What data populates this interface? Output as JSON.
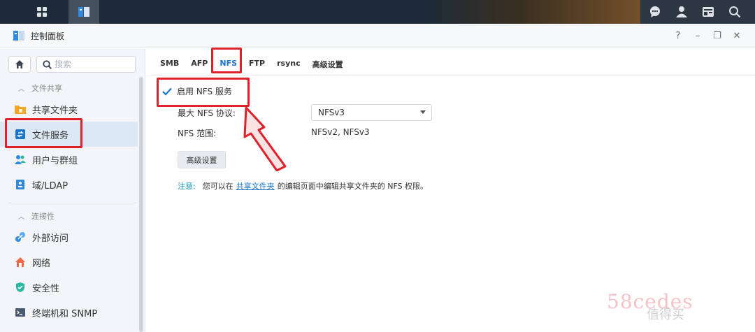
{
  "window": {
    "title": "控制面板",
    "controls": [
      "?",
      "–",
      "❐",
      "✕"
    ]
  },
  "sidebar": {
    "search_placeholder": "搜索",
    "groups": [
      {
        "header": "文件共享",
        "items": [
          {
            "label": "共享文件夹",
            "icon": "folder-icon"
          },
          {
            "label": "文件服务",
            "icon": "file-services-icon",
            "selected": true
          },
          {
            "label": "用户与群组",
            "icon": "users-icon"
          },
          {
            "label": "域/LDAP",
            "icon": "domain-icon"
          }
        ]
      },
      {
        "header": "连接性",
        "items": [
          {
            "label": "外部访问",
            "icon": "external-access-icon"
          },
          {
            "label": "网络",
            "icon": "network-icon"
          },
          {
            "label": "安全性",
            "icon": "shield-icon"
          },
          {
            "label": "终端机和 SNMP",
            "icon": "terminal-icon"
          }
        ]
      }
    ]
  },
  "tabs": [
    {
      "label": "SMB"
    },
    {
      "label": "AFP"
    },
    {
      "label": "NFS",
      "active": true
    },
    {
      "label": "FTP"
    },
    {
      "label": "rsync"
    },
    {
      "label": "高级设置"
    }
  ],
  "nfs": {
    "enable_label": "启用 NFS 服务",
    "enabled": true,
    "max_protocol_label": "最大 NFS 协议:",
    "max_protocol_value": "NFSv3",
    "range_label": "NFS 范围:",
    "range_value": "NFSv2, NFSv3",
    "advanced_button": "高级设置",
    "note_label": "注意:",
    "note_before": "您可以在",
    "note_link": "共享文件夹",
    "note_after": "的编辑页面中编辑共享文件夹的 NFS 权限。"
  },
  "watermark": {
    "text": "58cedes",
    "sub": "值得买"
  },
  "colors": {
    "accent": "#1a75c9",
    "highlight": "#e0202a",
    "note_label": "#1a9ab0"
  }
}
